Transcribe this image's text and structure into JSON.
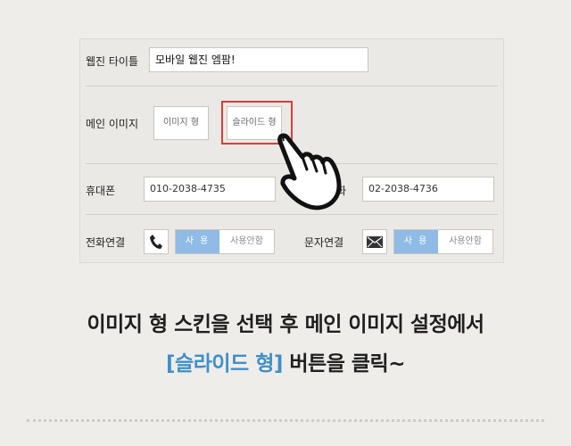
{
  "form": {
    "title_label": "웹진 타이틀",
    "title_value": "모바일 웹진 엠팜!",
    "main_image_label": "메인 이미지",
    "type_image_btn": "이미지 형",
    "type_slide_btn": "슬라이드 형",
    "mobile_label": "휴대폰",
    "mobile_value": "010-2038-4735",
    "phone_label_partial": "화",
    "phone_value": "02-2038-4736",
    "call_link_label": "전화연결",
    "call_use_on": "사 용",
    "call_use_off": "사용안함",
    "sms_link_label": "문자연결",
    "sms_use_on": "사 용",
    "sms_use_off": "사용안함"
  },
  "caption": {
    "line1": "이미지 형 스킨을 선택 후 메인 이미지 설정에서",
    "line2_accent": "[슬라이드 형]",
    "line2_rest": " 버튼을 클릭~"
  },
  "colors": {
    "accent": "#3f8fc7",
    "highlight": "#e03a3a",
    "toggle_on": "#8fbbe6"
  },
  "icons": [
    "phone-icon",
    "mail-icon",
    "pointing-hand-icon"
  ]
}
